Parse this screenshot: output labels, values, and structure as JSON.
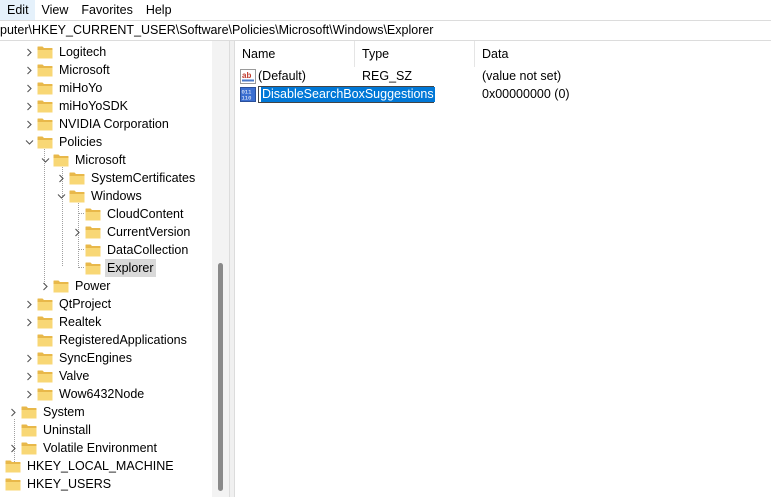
{
  "menu": [
    "Edit",
    "View",
    "Favorites",
    "Help"
  ],
  "address": "puter\\HKEY_CURRENT_USER\\Software\\Policies\\Microsoft\\Windows\\Explorer",
  "tree": [
    {
      "label": "Logitech"
    },
    {
      "label": "Microsoft"
    },
    {
      "label": "miHoYo"
    },
    {
      "label": "miHoYoSDK"
    },
    {
      "label": "NVIDIA Corporation"
    },
    {
      "label": "Policies"
    },
    {
      "label": "Microsoft"
    },
    {
      "label": "SystemCertificates"
    },
    {
      "label": "Windows"
    },
    {
      "label": "CloudContent"
    },
    {
      "label": "CurrentVersion"
    },
    {
      "label": "DataCollection"
    },
    {
      "label": "Explorer"
    },
    {
      "label": "Power"
    },
    {
      "label": "QtProject"
    },
    {
      "label": "Realtek"
    },
    {
      "label": "RegisteredApplications"
    },
    {
      "label": "SyncEngines"
    },
    {
      "label": "Valve"
    },
    {
      "label": "Wow6432Node"
    },
    {
      "label": "System"
    },
    {
      "label": "Uninstall"
    },
    {
      "label": "Volatile Environment"
    },
    {
      "label": "HKEY_LOCAL_MACHINE"
    },
    {
      "label": "HKEY_USERS"
    }
  ],
  "columns": {
    "name": "Name",
    "type": "Type",
    "data": "Data"
  },
  "values": [
    {
      "name": "(Default)",
      "type": "REG_SZ",
      "data": "(value not set)",
      "icon": "string-value-icon"
    },
    {
      "name": "DisableSearchBoxSuggestions",
      "type": "",
      "data": "0x00000000 (0)",
      "icon": "binary-value-icon",
      "editing": true
    }
  ],
  "colors": {
    "selection": "#0078d7",
    "folder": "#f8d775",
    "folder_dark": "#e8b84a"
  }
}
